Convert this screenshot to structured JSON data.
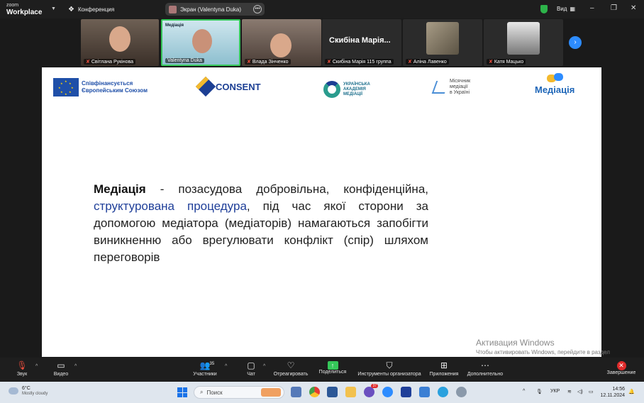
{
  "titlebar": {
    "brand_small": "zoom",
    "brand_big": "Workplace",
    "conference_label": "Конференция",
    "share_label": "Экран (Valentyna Duka)",
    "view_label": "Вид"
  },
  "participants": [
    {
      "name": "Світлана Рукінова",
      "muted": true
    },
    {
      "name": "Valentyna Duka",
      "muted": false,
      "tile_logo": "Медіація"
    },
    {
      "name": "Влада Зінченко",
      "muted": true
    },
    {
      "name": "Скибіна Марія 115 группа",
      "muted": true,
      "big_name": "Скибіна Марія..."
    },
    {
      "name": "Аліна Лавенко",
      "muted": true
    },
    {
      "name": "Катя Мацько",
      "muted": true
    }
  ],
  "slide": {
    "logos": {
      "eu": [
        "Співфінансується",
        "Європейським Союзом"
      ],
      "consent": "CONSENT",
      "uam": [
        "УКРАЇНСЬКА",
        "АКАДЕМІЯ",
        "МЕДІАЦІЇ"
      ],
      "month": [
        "Місячник",
        "медіації",
        "в Україні"
      ],
      "mediation": "Медіація"
    },
    "term": "Медіація",
    "text_part1": " - позасудова добровільна, конфіденційна, ",
    "highlight": "структурована процедура",
    "text_part2": ", під час якої сторони за допомогою медіатора (медіаторів) намагаються запобігти виникненню або врегулювати конфлікт (спір) шляхом переговорів"
  },
  "activation": {
    "title": "Активация Windows",
    "text": "Чтобы активировать Windows, перейдите в раздел \"Параметры\"."
  },
  "toolbar": {
    "audio": "Звук",
    "video": "Видео",
    "participants": "Участники",
    "participants_count": "35",
    "chat": "Чат",
    "react": "Отреагировать",
    "share": "Поделиться",
    "host_tools": "Инструменты организатора",
    "apps": "Приложения",
    "more": "Дополнительно",
    "end": "Завершение"
  },
  "taskbar": {
    "temp": "6°C",
    "weather": "Mostly cloudy",
    "search_placeholder": "Поиск",
    "lang": "УКР",
    "time": "14:56",
    "date": "12.11.2024",
    "badge_count": "37"
  }
}
